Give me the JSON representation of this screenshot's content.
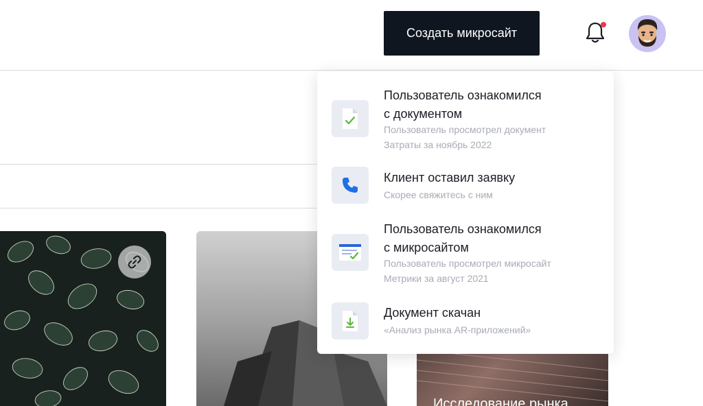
{
  "header": {
    "create_button_label": "Создать микросайт"
  },
  "notifications": [
    {
      "icon": "document-check-icon",
      "title_line1": "Пользователь ознакомился",
      "title_line2": "с документом",
      "sub_line1": "Пользователь просмотрел документ",
      "sub_line2": "Затраты за ноябрь 2022"
    },
    {
      "icon": "phone-icon",
      "title_line1": "Клиент оставил заявку",
      "sub_line1": "Скорее свяжитесь с ним"
    },
    {
      "icon": "microsite-check-icon",
      "title_line1": "Пользователь ознакомился",
      "title_line2": "с микросайтом",
      "sub_line1": "Пользователь просмотрел микросайт",
      "sub_line2": "Метрики за август 2021"
    },
    {
      "icon": "document-download-icon",
      "title_line1": "Документ скачан",
      "sub_line1": "«Анализ рынка AR-приложений»"
    }
  ],
  "cards": [
    {
      "image": "leaves-photo"
    },
    {
      "image": "architecture-photo"
    },
    {
      "image": "abstract-photo",
      "title": "Исследование рынка"
    }
  ],
  "colors": {
    "primary_button": "#0f1620",
    "badge": "#f0354a",
    "avatar_bg": "#c9c2f2",
    "icon_tile_bg": "#e9ecf3",
    "phone_blue": "#1f6fe6",
    "check_green": "#5bb53a"
  }
}
